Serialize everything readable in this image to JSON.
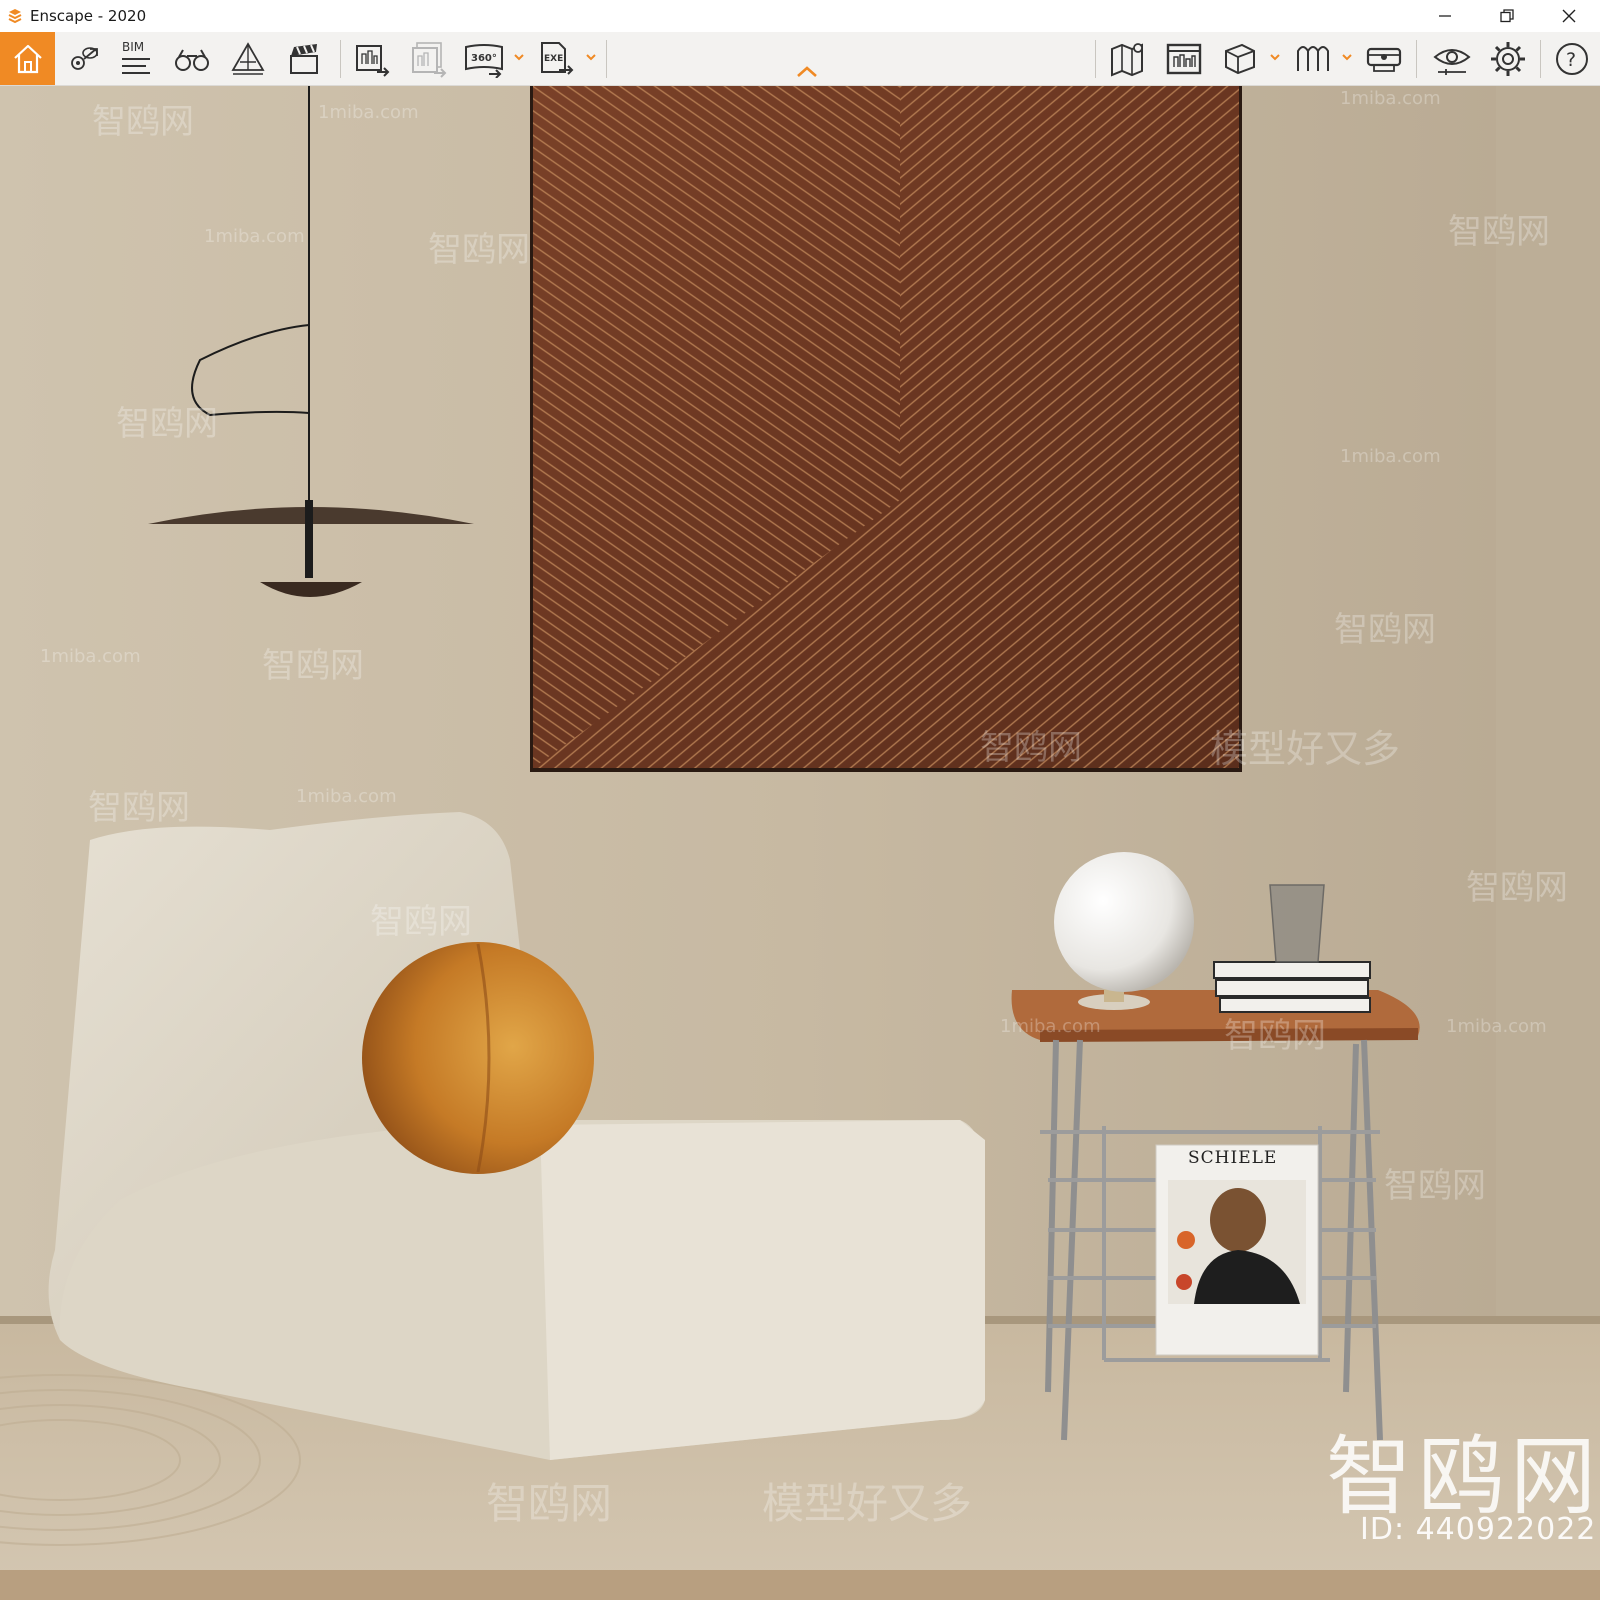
{
  "window": {
    "title": "Enscape - 2020",
    "controls": [
      "minimize",
      "restore",
      "close"
    ]
  },
  "toolbar": {
    "accent_color": "#f08a24",
    "left_group": [
      {
        "name": "home",
        "icon": "home-icon",
        "active": true
      },
      {
        "name": "bookmarks",
        "icon": "map-pin-icon"
      },
      {
        "name": "bim",
        "icon": "bim-icon",
        "label": "BIM"
      },
      {
        "name": "binoculars",
        "icon": "binoculars-icon"
      },
      {
        "name": "atmosphere",
        "icon": "pyramid-icon"
      },
      {
        "name": "video-editor",
        "icon": "clapperboard-icon"
      }
    ],
    "export_group": [
      {
        "name": "screenshot",
        "icon": "export-image-icon"
      },
      {
        "name": "batch-render",
        "icon": "batch-export-icon",
        "disabled": true
      },
      {
        "name": "panorama",
        "icon": "panorama-360-icon",
        "label": "360°",
        "has_dropdown": true
      },
      {
        "name": "exe-export",
        "icon": "exe-export-icon",
        "label": "EXE",
        "has_dropdown": true
      }
    ],
    "right_group": [
      {
        "name": "map",
        "icon": "map-icon"
      },
      {
        "name": "asset-library",
        "icon": "asset-library-icon"
      },
      {
        "name": "view-mode",
        "icon": "cube-icon",
        "has_dropdown": true
      },
      {
        "name": "material",
        "icon": "material-icon",
        "has_dropdown": true
      },
      {
        "name": "vr",
        "icon": "vr-headset-icon"
      },
      {
        "name": "visual-settings",
        "icon": "eye-icon"
      },
      {
        "name": "settings",
        "icon": "gear-icon"
      },
      {
        "name": "help",
        "icon": "help-icon",
        "label": "?"
      }
    ]
  },
  "scene": {
    "book_title": "SCHIELE",
    "watermarks": {
      "site": "1miba.com",
      "brand": "智鸥网",
      "slogan": "模型好又多",
      "id": "ID: 440922022"
    },
    "colors": {
      "wall": "#cdbfa9",
      "floor": "#cbbda4",
      "painting": "#6b3a22",
      "chair": "#e2dccd",
      "pillow": "#c9822a",
      "table_top": "#b06a3c"
    }
  }
}
